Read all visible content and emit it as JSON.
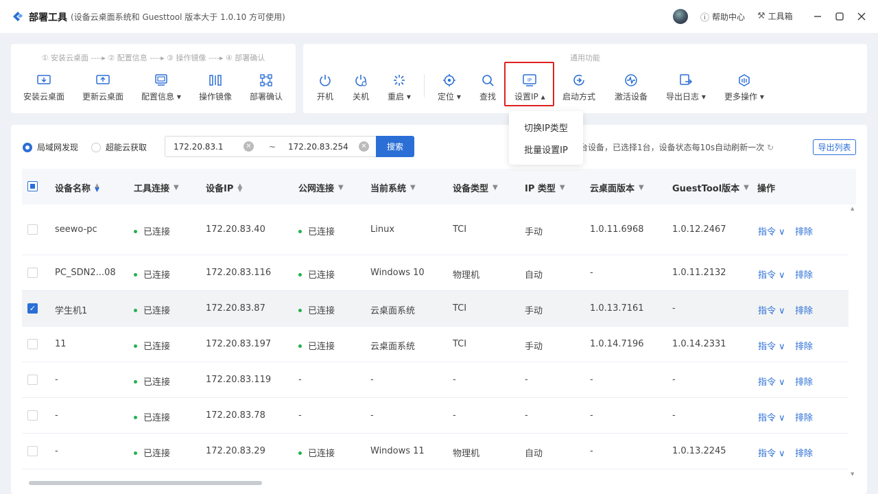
{
  "app": {
    "name": "部署工具",
    "subtitle": "(设备云桌面系统和 Guesttool 版本大于 1.0.10 方可使用)",
    "help": "帮助中心",
    "toolbox": "工具箱"
  },
  "left_panel": {
    "steps": "① 安装云桌面 ----▸ ② 配置信息 ----▸ ③ 操作镜像 ----▸ ④ 部署确认",
    "tools": [
      "安装云桌面",
      "更新云桌面",
      "配置信息 ▾",
      "操作镜像",
      "部署确认"
    ]
  },
  "right_panel": {
    "title": "通用功能",
    "tools": [
      "开机",
      "关机",
      "重启 ▾",
      "定位 ▾",
      "查找",
      "设置IP ▴",
      "启动方式",
      "激活设备",
      "导出日志 ▾",
      "更多操作 ▾"
    ]
  },
  "dropdown": {
    "items": [
      "切换IP类型",
      "批量设置IP"
    ]
  },
  "filter": {
    "radio_lan": "局域网发现",
    "radio_cloud": "超能云获取",
    "ip_start": "172.20.83.1",
    "tilde": "~",
    "ip_end": "172.20.83.254",
    "search": "搜索",
    "status": "台设备，已选择1台，设备状态每10s自动刷新一次",
    "export": "导出列表"
  },
  "table": {
    "headers": [
      "设备名称",
      "工具连接",
      "设备IP",
      "公网连接",
      "当前系统",
      "设备类型",
      "IP 类型",
      "云桌面版本",
      "GuestTool版本",
      "操作"
    ],
    "op_cmd": "指令 ∨",
    "op_remove": "排除",
    "rows": [
      {
        "name": "seewo-pc",
        "tool": "已连接",
        "ip": "172.20.83.40",
        "net": "已连接",
        "os": "Linux",
        "type": "TCI",
        "iptype": "手动",
        "ver": "1.0.11.6968",
        "gt": "1.0.12.2467",
        "checked": false,
        "tool_dot": true,
        "net_dot": true
      },
      {
        "name": "PC_SDN2...08",
        "tool": "已连接",
        "ip": "172.20.83.116",
        "net": "已连接",
        "os": "Windows 10",
        "type": "物理机",
        "iptype": "自动",
        "ver": "-",
        "gt": "1.0.11.2132",
        "checked": false,
        "tool_dot": true,
        "net_dot": true
      },
      {
        "name": "学生机1",
        "tool": "已连接",
        "ip": "172.20.83.87",
        "net": "已连接",
        "os": "云桌面系统",
        "type": "TCI",
        "iptype": "手动",
        "ver": "1.0.13.7161",
        "gt": "-",
        "checked": true,
        "tool_dot": true,
        "net_dot": true
      },
      {
        "name": "11",
        "tool": "已连接",
        "ip": "172.20.83.197",
        "net": "已连接",
        "os": "云桌面系统",
        "type": "TCI",
        "iptype": "手动",
        "ver": "1.0.14.7196",
        "gt": "1.0.14.2331",
        "checked": false,
        "tool_dot": true,
        "net_dot": true
      },
      {
        "name": "-",
        "tool": "已连接",
        "ip": "172.20.83.119",
        "net": "-",
        "os": "-",
        "type": "-",
        "iptype": "-",
        "ver": "-",
        "gt": "-",
        "checked": false,
        "tool_dot": true,
        "net_dot": false
      },
      {
        "name": "-",
        "tool": "已连接",
        "ip": "172.20.83.78",
        "net": "-",
        "os": "-",
        "type": "-",
        "iptype": "-",
        "ver": "-",
        "gt": "-",
        "checked": false,
        "tool_dot": true,
        "net_dot": false
      },
      {
        "name": "-",
        "tool": "已连接",
        "ip": "172.20.83.29",
        "net": "已连接",
        "os": "Windows 11",
        "type": "物理机",
        "iptype": "自动",
        "ver": "-",
        "gt": "1.0.13.2245",
        "checked": false,
        "tool_dot": true,
        "net_dot": true
      }
    ]
  },
  "colors": {
    "accent": "#2b6fd6",
    "connected": "#22b24c",
    "highlight": "#e02020"
  }
}
